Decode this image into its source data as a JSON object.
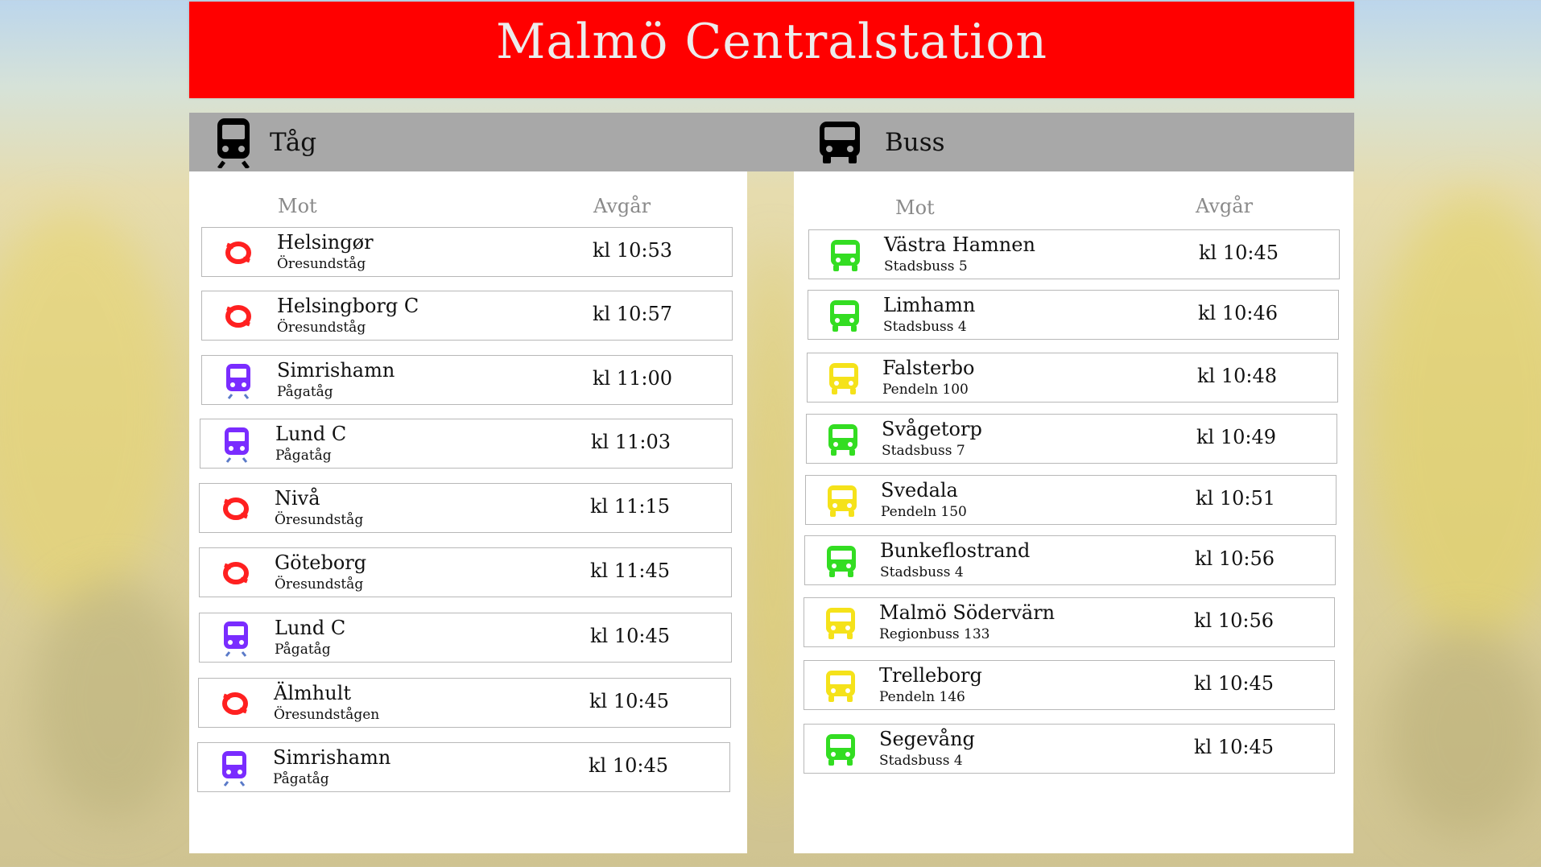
{
  "title": "Malmö Centralstation",
  "colors": {
    "header": "#ff0000",
    "oresund": "#ff2020",
    "pagatag": "#7a2cff",
    "bus_green": "#33dd22",
    "bus_yellow": "#f5e21a"
  },
  "train": {
    "heading": "Tåg",
    "icon": "train-icon",
    "col_dest": "Mot",
    "col_time": "Avgår",
    "rows": [
      {
        "dest": "Helsingør",
        "type": "Öresundståg",
        "time": "kl 10:53",
        "icon": "oresund-logo-icon"
      },
      {
        "dest": "Helsingborg C",
        "type": "Öresundståg",
        "time": "kl 10:57",
        "icon": "oresund-logo-icon"
      },
      {
        "dest": "Simrishamn",
        "type": "Pågatåg",
        "time": "kl 11:00",
        "icon": "pagatag-train-icon"
      },
      {
        "dest": "Lund C",
        "type": "Pågatåg",
        "time": "kl 11:03",
        "icon": "pagatag-train-icon"
      },
      {
        "dest": "Nivå",
        "type": "Öresundståg",
        "time": "kl 11:15",
        "icon": "oresund-logo-icon"
      },
      {
        "dest": "Göteborg",
        "type": "Öresundståg",
        "time": "kl 11:45",
        "icon": "oresund-logo-icon"
      },
      {
        "dest": "Lund C",
        "type": "Pågatåg",
        "time": "kl 10:45",
        "icon": "pagatag-train-icon"
      },
      {
        "dest": "Älmhult",
        "type": "Öresundstågen",
        "time": "kl 10:45",
        "icon": "oresund-logo-icon"
      },
      {
        "dest": "Simrishamn",
        "type": "Pågatåg",
        "time": "kl 10:45",
        "icon": "pagatag-train-icon"
      }
    ]
  },
  "bus": {
    "heading": "Buss",
    "icon": "bus-icon",
    "col_dest": "Mot",
    "col_time": "Avgår",
    "rows": [
      {
        "dest": "Västra Hamnen",
        "type": "Stadsbuss 5",
        "time": "kl 10:45",
        "icon": "green-bus-icon"
      },
      {
        "dest": "Limhamn",
        "type": "Stadsbuss 4",
        "time": "kl 10:46",
        "icon": "green-bus-icon"
      },
      {
        "dest": "Falsterbo",
        "type": "Pendeln 100",
        "time": "kl 10:48",
        "icon": "yellow-bus-icon"
      },
      {
        "dest": "Svågetorp",
        "type": "Stadsbuss 7",
        "time": "kl 10:49",
        "icon": "green-bus-icon"
      },
      {
        "dest": "Svedala",
        "type": "Pendeln 150",
        "time": "kl 10:51",
        "icon": "yellow-bus-icon"
      },
      {
        "dest": "Bunkeflostrand",
        "type": "Stadsbuss 4",
        "time": "kl 10:56",
        "icon": "green-bus-icon"
      },
      {
        "dest": "Malmö Södervärn",
        "type": "Regionbuss 133",
        "time": "kl 10:56",
        "icon": "yellow-bus-icon"
      },
      {
        "dest": "Trelleborg",
        "type": "Pendeln 146",
        "time": "kl 10:45",
        "icon": "yellow-bus-icon"
      },
      {
        "dest": "Segevång",
        "type": "Stadsbuss 4",
        "time": "kl 10:45",
        "icon": "green-bus-icon"
      }
    ]
  }
}
